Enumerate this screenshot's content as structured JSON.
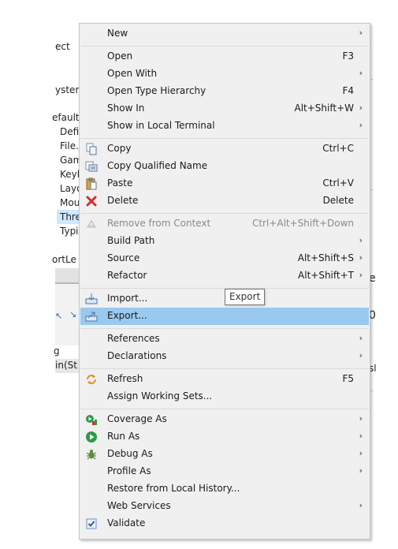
{
  "background": {
    "fragments": [
      "ect",
      "ystem",
      "efault",
      "Defi",
      "File.j",
      "Gam",
      "Keyb",
      "Layo",
      "Mou",
      "Thre",
      "Typi",
      "ortLe",
      "g",
      "in(St",
      "e",
      "0",
      "sl"
    ]
  },
  "tooltip": "Export",
  "menu": {
    "items": [
      {
        "label": "New",
        "shortcut": "",
        "arrow": "›",
        "icon": ""
      },
      {
        "label": "Open",
        "shortcut": "F3",
        "arrow": "",
        "icon": ""
      },
      {
        "label": "Open With",
        "shortcut": "",
        "arrow": "›",
        "icon": ""
      },
      {
        "label": "Open Type Hierarchy",
        "shortcut": "F4",
        "arrow": "",
        "icon": ""
      },
      {
        "label": "Show In",
        "shortcut": "Alt+Shift+W",
        "arrow": "›",
        "icon": ""
      },
      {
        "label": "Show in Local Terminal",
        "shortcut": "",
        "arrow": "›",
        "icon": ""
      },
      {
        "label": "Copy",
        "shortcut": "Ctrl+C",
        "arrow": "",
        "icon": "copy-icon"
      },
      {
        "label": "Copy Qualified Name",
        "shortcut": "",
        "arrow": "",
        "icon": "copy-qualified-name-icon"
      },
      {
        "label": "Paste",
        "shortcut": "Ctrl+V",
        "arrow": "",
        "icon": "paste-icon"
      },
      {
        "label": "Delete",
        "shortcut": "Delete",
        "arrow": "",
        "icon": "delete-icon"
      },
      {
        "label": "Remove from Context",
        "shortcut": "Ctrl+Alt+Shift+Down",
        "arrow": "",
        "icon": "remove-from-context-icon"
      },
      {
        "label": "Build Path",
        "shortcut": "",
        "arrow": "›",
        "icon": ""
      },
      {
        "label": "Source",
        "shortcut": "Alt+Shift+S",
        "arrow": "›",
        "icon": ""
      },
      {
        "label": "Refactor",
        "shortcut": "Alt+Shift+T",
        "arrow": "›",
        "icon": ""
      },
      {
        "label": "Import...",
        "shortcut": "",
        "arrow": "",
        "icon": "import-icon"
      },
      {
        "label": "Export...",
        "shortcut": "",
        "arrow": "",
        "icon": "export-icon"
      },
      {
        "label": "References",
        "shortcut": "",
        "arrow": "›",
        "icon": ""
      },
      {
        "label": "Declarations",
        "shortcut": "",
        "arrow": "›",
        "icon": ""
      },
      {
        "label": "Refresh",
        "shortcut": "F5",
        "arrow": "",
        "icon": "refresh-icon"
      },
      {
        "label": "Assign Working Sets...",
        "shortcut": "",
        "arrow": "",
        "icon": ""
      },
      {
        "label": "Coverage As",
        "shortcut": "",
        "arrow": "›",
        "icon": "coverage-icon"
      },
      {
        "label": "Run As",
        "shortcut": "",
        "arrow": "›",
        "icon": "run-icon"
      },
      {
        "label": "Debug As",
        "shortcut": "",
        "arrow": "›",
        "icon": "debug-icon"
      },
      {
        "label": "Profile As",
        "shortcut": "",
        "arrow": "›",
        "icon": ""
      },
      {
        "label": "Restore from Local History...",
        "shortcut": "",
        "arrow": "",
        "icon": ""
      },
      {
        "label": "Web Services",
        "shortcut": "",
        "arrow": "›",
        "icon": ""
      },
      {
        "label": "Validate",
        "shortcut": "",
        "arrow": "",
        "icon": "validate-checkbox-icon"
      }
    ]
  }
}
